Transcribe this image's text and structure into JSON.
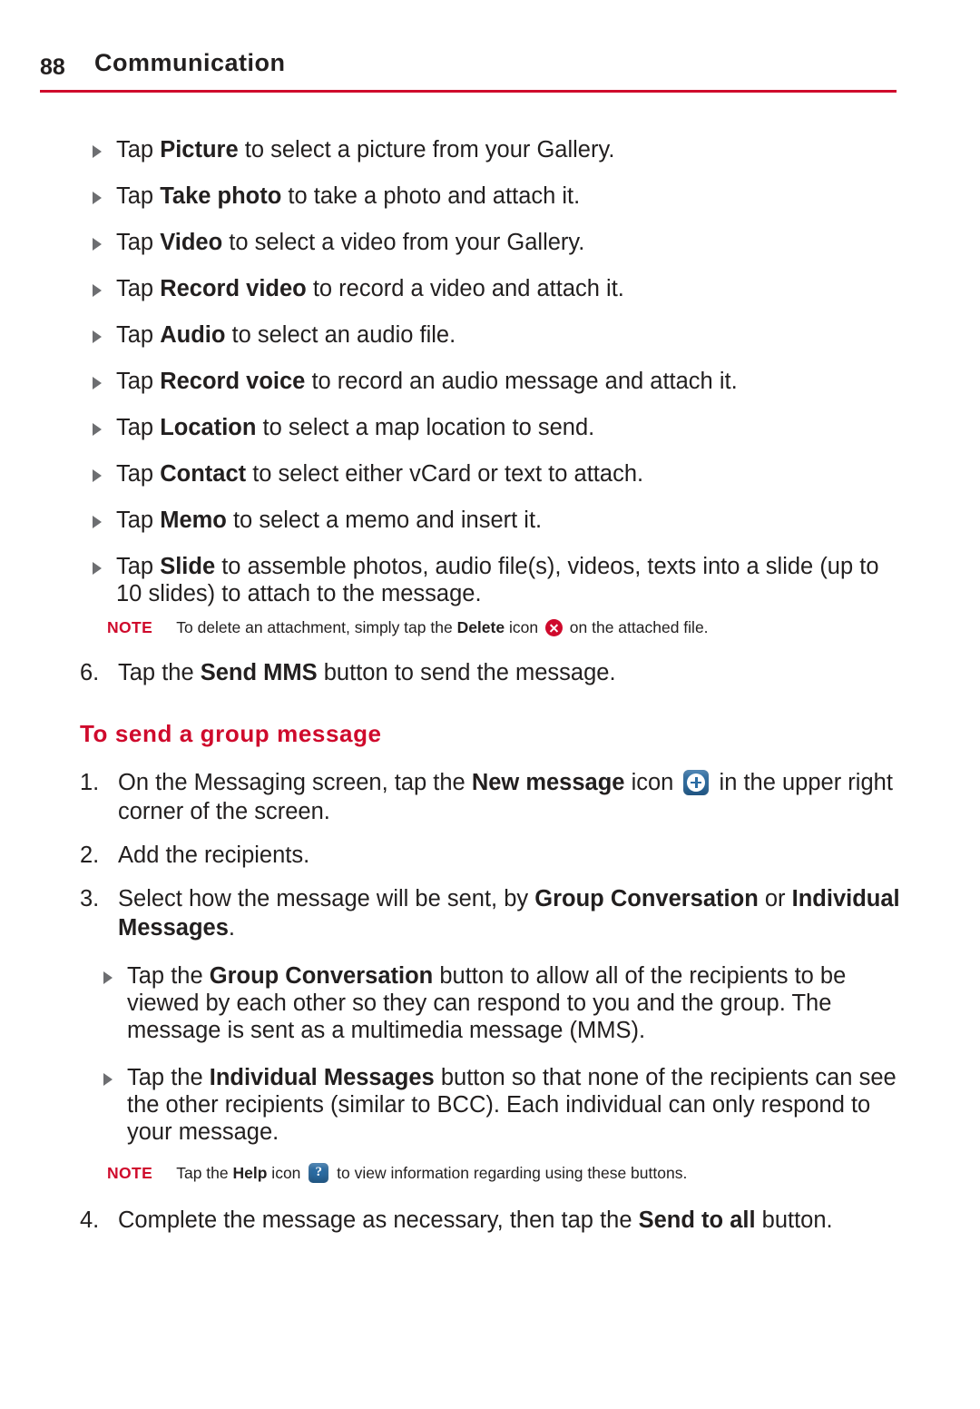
{
  "header": {
    "page_number": "88",
    "chapter": "Communication",
    "rule_color": "#cf0a2c"
  },
  "attachment_bullets": [
    {
      "pre": "Tap ",
      "bold": "Picture",
      "post": " to select a picture from your Gallery."
    },
    {
      "pre": "Tap ",
      "bold": "Take photo",
      "post": " to take a photo and attach it."
    },
    {
      "pre": "Tap ",
      "bold": "Video",
      "post": " to select a video from your Gallery."
    },
    {
      "pre": "Tap ",
      "bold": "Record video",
      "post": " to record a video and attach it."
    },
    {
      "pre": "Tap ",
      "bold": "Audio",
      "post": " to select an audio file."
    },
    {
      "pre": "Tap ",
      "bold": "Record voice",
      "post": " to record an audio message and attach it."
    },
    {
      "pre": "Tap ",
      "bold": "Location",
      "post": " to select a map location to send."
    },
    {
      "pre": "Tap ",
      "bold": "Contact",
      "post": " to select either vCard or text to attach."
    },
    {
      "pre": "Tap ",
      "bold": "Memo",
      "post": " to select a memo and insert it."
    },
    {
      "pre": "Tap ",
      "bold": "Slide",
      "post": " to assemble photos, audio file(s), videos, texts into a slide (up to 10 slides) to attach to the message."
    }
  ],
  "note_delete": {
    "label": "NOTE",
    "pre": "To delete an attachment, simply tap the ",
    "bold": "Delete",
    "mid": " icon ",
    "icon": "delete-x-icon",
    "post": " on the attached file."
  },
  "step6": {
    "num": "6.",
    "pre": "Tap the ",
    "bold": "Send MMS",
    "post": " button to send the message."
  },
  "section_title": "To send a group message",
  "step1": {
    "num": "1.",
    "pre": "On the Messaging screen, tap the ",
    "bold": "New message",
    "mid": " icon ",
    "icon": "new-message-plus-icon",
    "post": " in the upper right corner of the screen."
  },
  "step2": {
    "num": "2.",
    "text": "Add the recipients."
  },
  "step3": {
    "num": "3.",
    "pre": "Select how the message will be sent, by ",
    "bold1": "Group Conversation",
    "mid": " or ",
    "bold2": "Individual Messages",
    "post": "."
  },
  "group_bullets": [
    {
      "pre": "Tap the ",
      "bold": "Group Conversation",
      "post": " button to allow all of the recipients to be viewed by each other so they can respond to you and the group. The message is sent as a multimedia message (MMS)."
    },
    {
      "pre": "Tap the ",
      "bold": "Individual Messages",
      "post": " button so that none of the recipients can see the other recipients (similar to BCC). Each individual can only respond to your message."
    }
  ],
  "note_help": {
    "label": "NOTE",
    "pre": "Tap the ",
    "bold": "Help",
    "mid": " icon ",
    "icon": "help-question-icon",
    "post": " to view information regarding using these buttons."
  },
  "step4": {
    "num": "4.",
    "pre": "Complete the message as necessary, then tap the ",
    "bold": "Send to all",
    "post": " button."
  }
}
